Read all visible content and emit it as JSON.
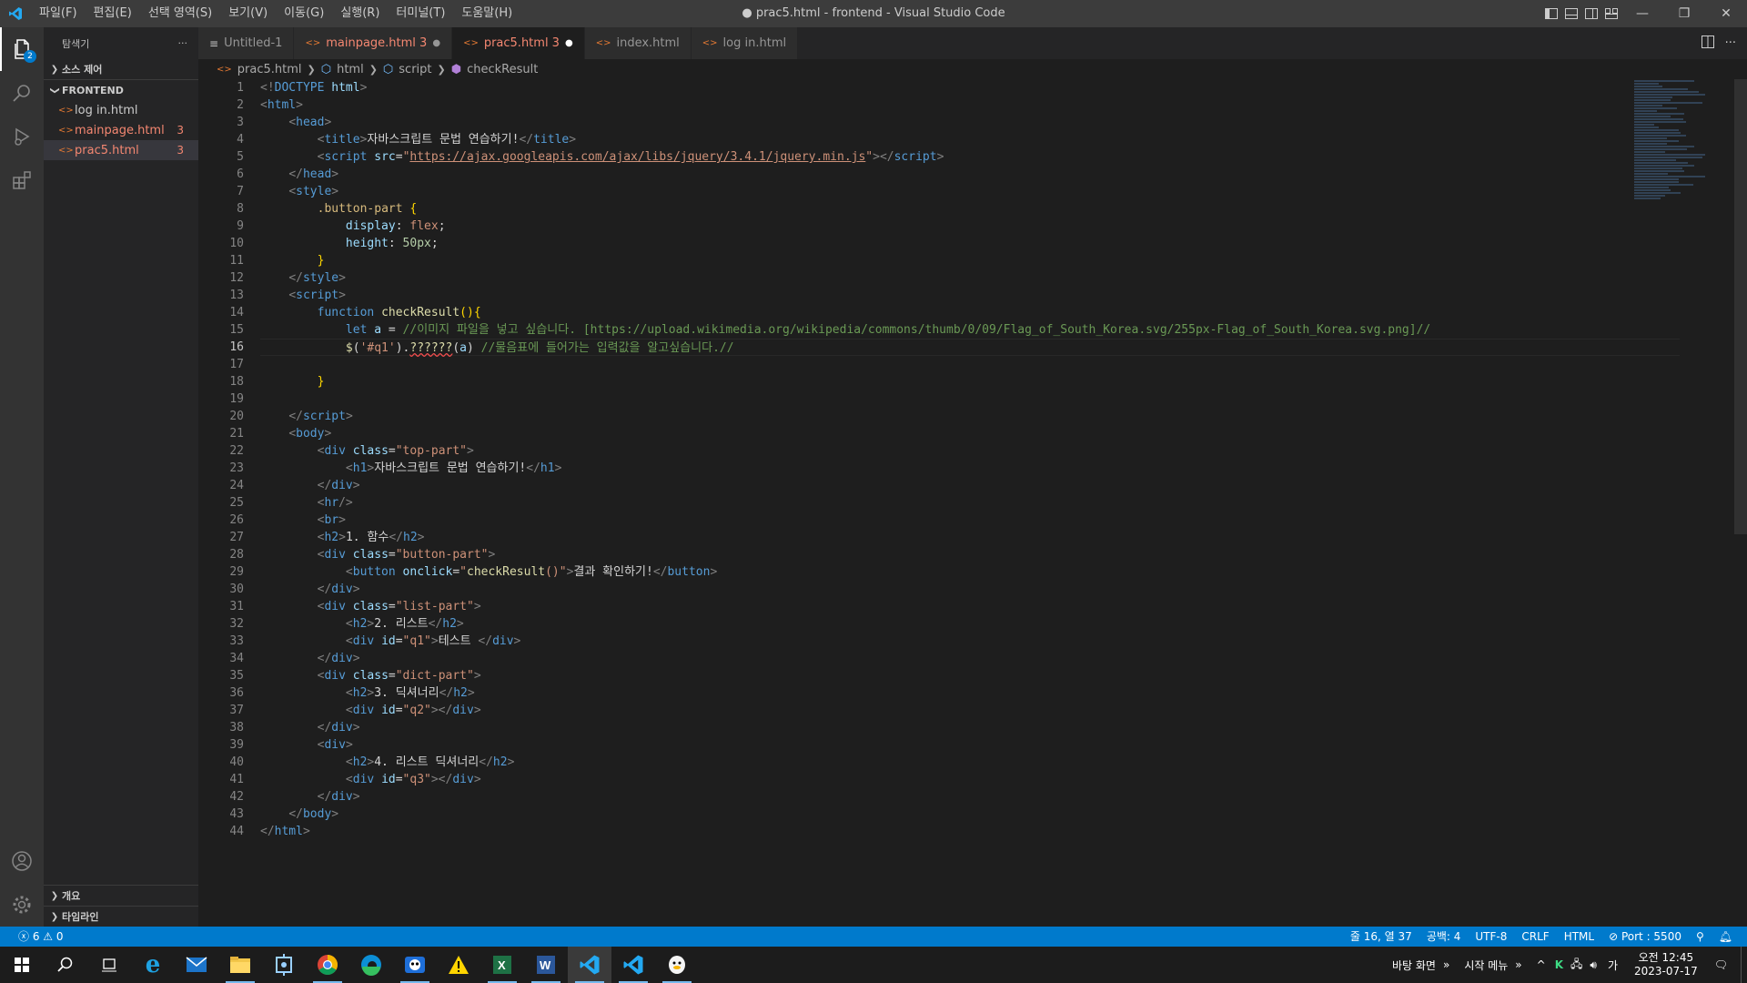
{
  "titlebar": {
    "menu": [
      "파일(F)",
      "편집(E)",
      "선택 영역(S)",
      "보기(V)",
      "이동(G)",
      "실행(R)",
      "터미널(T)",
      "도움말(H)"
    ],
    "window_title": "● prac5.html - frontend - Visual Studio Code",
    "minimize": "—",
    "restore": "❐",
    "close": "✕"
  },
  "activity": {
    "explorer_badge": "2"
  },
  "sidebar": {
    "header": "탐색기",
    "more": "···",
    "source_control": "소스 제어",
    "folder": "FRONTEND",
    "files": [
      {
        "name": "log in.html",
        "count": "",
        "color": "#cccccc"
      },
      {
        "name": "mainpage.html",
        "count": "3",
        "color": "#f48771"
      },
      {
        "name": "prac5.html",
        "count": "3",
        "color": "#f48771"
      }
    ],
    "outline": "개요",
    "timeline": "타임라인"
  },
  "tabs": [
    {
      "label": "Untitled-1",
      "mod": "",
      "color": "#969696"
    },
    {
      "label": "mainpage.html 3",
      "mod": "●",
      "color": "#f48771"
    },
    {
      "label": "prac5.html 3",
      "mod": "●",
      "color": "#f48771"
    },
    {
      "label": "index.html",
      "mod": "",
      "color": "#969696"
    },
    {
      "label": "log in.html",
      "mod": "",
      "color": "#969696"
    }
  ],
  "breadcrumb": [
    "prac5.html",
    "html",
    "script",
    "checkResult"
  ],
  "editor": {
    "current_line": 16,
    "strings": {
      "title_text": "자바스크립트 문법 연습하기!",
      "jquery_url": "https://ajax.googleapis.com/ajax/libs/jquery/3.4.1/jquery.min.js",
      "comment15": "//이미지 파일을 넣고 싶습니다. [https://upload.wikimedia.org/wikipedia/commons/thumb/0/09/Flag_of_South_Korea.svg/255px-Flag_of_South_Korea.svg.png]//",
      "comment16": "//물음표에 들어가는 입력값을 알고싶습니다.//",
      "qmarks": "??????",
      "h1_text": "자바스크립트 문법 연습하기!",
      "h2_1": "1. 함수",
      "button_text": "결과 확인하기!",
      "h2_2": "2. 리스트",
      "q1_text": "테스트 ",
      "h2_3": "3. 딕셔너리",
      "h2_4": "4. 리스트 딕셔너리"
    }
  },
  "statusbar": {
    "problems": "ⓧ 6 ⚠ 0",
    "position": "줄 16, 열 37",
    "spaces": "공백: 4",
    "encoding": "UTF-8",
    "eol": "CRLF",
    "language": "HTML",
    "port": "⊘ Port : 5500"
  },
  "taskbar": {
    "desktop": "바탕 화면",
    "start_menu": "시작 메뉴",
    "ime": "가",
    "time": "오전 12:45",
    "date": "2023-07-17"
  }
}
